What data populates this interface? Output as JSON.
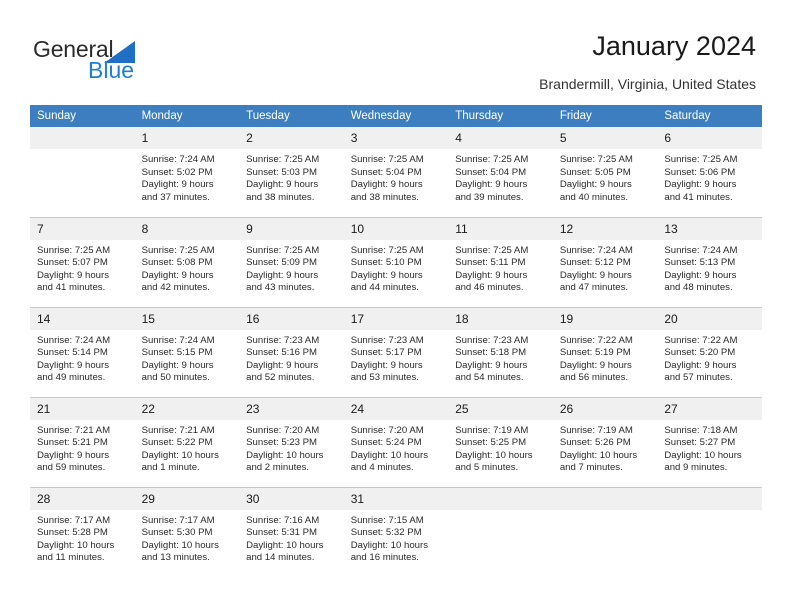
{
  "brand": {
    "name_top": "General",
    "name_bottom": "Blue",
    "accent_color": "#1f7fd0",
    "triangle_color": "#1f6fc4"
  },
  "header": {
    "title": "January 2024",
    "subtitle": "Brandermill, Virginia, United States"
  },
  "theme": {
    "header_row_bg": "#3c7ebf",
    "daynum_bg": "#f0f0f0",
    "grid_line": "#c9c9c9",
    "text_color": "#2b2b2b"
  },
  "weekday_headers": [
    "Sunday",
    "Monday",
    "Tuesday",
    "Wednesday",
    "Thursday",
    "Friday",
    "Saturday"
  ],
  "weeks": [
    [
      {
        "day": "",
        "sunrise": "",
        "sunset": "",
        "daylight1": "",
        "daylight2": ""
      },
      {
        "day": "1",
        "sunrise": "Sunrise: 7:24 AM",
        "sunset": "Sunset: 5:02 PM",
        "daylight1": "Daylight: 9 hours",
        "daylight2": "and 37 minutes."
      },
      {
        "day": "2",
        "sunrise": "Sunrise: 7:25 AM",
        "sunset": "Sunset: 5:03 PM",
        "daylight1": "Daylight: 9 hours",
        "daylight2": "and 38 minutes."
      },
      {
        "day": "3",
        "sunrise": "Sunrise: 7:25 AM",
        "sunset": "Sunset: 5:04 PM",
        "daylight1": "Daylight: 9 hours",
        "daylight2": "and 38 minutes."
      },
      {
        "day": "4",
        "sunrise": "Sunrise: 7:25 AM",
        "sunset": "Sunset: 5:04 PM",
        "daylight1": "Daylight: 9 hours",
        "daylight2": "and 39 minutes."
      },
      {
        "day": "5",
        "sunrise": "Sunrise: 7:25 AM",
        "sunset": "Sunset: 5:05 PM",
        "daylight1": "Daylight: 9 hours",
        "daylight2": "and 40 minutes."
      },
      {
        "day": "6",
        "sunrise": "Sunrise: 7:25 AM",
        "sunset": "Sunset: 5:06 PM",
        "daylight1": "Daylight: 9 hours",
        "daylight2": "and 41 minutes."
      }
    ],
    [
      {
        "day": "7",
        "sunrise": "Sunrise: 7:25 AM",
        "sunset": "Sunset: 5:07 PM",
        "daylight1": "Daylight: 9 hours",
        "daylight2": "and 41 minutes."
      },
      {
        "day": "8",
        "sunrise": "Sunrise: 7:25 AM",
        "sunset": "Sunset: 5:08 PM",
        "daylight1": "Daylight: 9 hours",
        "daylight2": "and 42 minutes."
      },
      {
        "day": "9",
        "sunrise": "Sunrise: 7:25 AM",
        "sunset": "Sunset: 5:09 PM",
        "daylight1": "Daylight: 9 hours",
        "daylight2": "and 43 minutes."
      },
      {
        "day": "10",
        "sunrise": "Sunrise: 7:25 AM",
        "sunset": "Sunset: 5:10 PM",
        "daylight1": "Daylight: 9 hours",
        "daylight2": "and 44 minutes."
      },
      {
        "day": "11",
        "sunrise": "Sunrise: 7:25 AM",
        "sunset": "Sunset: 5:11 PM",
        "daylight1": "Daylight: 9 hours",
        "daylight2": "and 46 minutes."
      },
      {
        "day": "12",
        "sunrise": "Sunrise: 7:24 AM",
        "sunset": "Sunset: 5:12 PM",
        "daylight1": "Daylight: 9 hours",
        "daylight2": "and 47 minutes."
      },
      {
        "day": "13",
        "sunrise": "Sunrise: 7:24 AM",
        "sunset": "Sunset: 5:13 PM",
        "daylight1": "Daylight: 9 hours",
        "daylight2": "and 48 minutes."
      }
    ],
    [
      {
        "day": "14",
        "sunrise": "Sunrise: 7:24 AM",
        "sunset": "Sunset: 5:14 PM",
        "daylight1": "Daylight: 9 hours",
        "daylight2": "and 49 minutes."
      },
      {
        "day": "15",
        "sunrise": "Sunrise: 7:24 AM",
        "sunset": "Sunset: 5:15 PM",
        "daylight1": "Daylight: 9 hours",
        "daylight2": "and 50 minutes."
      },
      {
        "day": "16",
        "sunrise": "Sunrise: 7:23 AM",
        "sunset": "Sunset: 5:16 PM",
        "daylight1": "Daylight: 9 hours",
        "daylight2": "and 52 minutes."
      },
      {
        "day": "17",
        "sunrise": "Sunrise: 7:23 AM",
        "sunset": "Sunset: 5:17 PM",
        "daylight1": "Daylight: 9 hours",
        "daylight2": "and 53 minutes."
      },
      {
        "day": "18",
        "sunrise": "Sunrise: 7:23 AM",
        "sunset": "Sunset: 5:18 PM",
        "daylight1": "Daylight: 9 hours",
        "daylight2": "and 54 minutes."
      },
      {
        "day": "19",
        "sunrise": "Sunrise: 7:22 AM",
        "sunset": "Sunset: 5:19 PM",
        "daylight1": "Daylight: 9 hours",
        "daylight2": "and 56 minutes."
      },
      {
        "day": "20",
        "sunrise": "Sunrise: 7:22 AM",
        "sunset": "Sunset: 5:20 PM",
        "daylight1": "Daylight: 9 hours",
        "daylight2": "and 57 minutes."
      }
    ],
    [
      {
        "day": "21",
        "sunrise": "Sunrise: 7:21 AM",
        "sunset": "Sunset: 5:21 PM",
        "daylight1": "Daylight: 9 hours",
        "daylight2": "and 59 minutes."
      },
      {
        "day": "22",
        "sunrise": "Sunrise: 7:21 AM",
        "sunset": "Sunset: 5:22 PM",
        "daylight1": "Daylight: 10 hours",
        "daylight2": "and 1 minute."
      },
      {
        "day": "23",
        "sunrise": "Sunrise: 7:20 AM",
        "sunset": "Sunset: 5:23 PM",
        "daylight1": "Daylight: 10 hours",
        "daylight2": "and 2 minutes."
      },
      {
        "day": "24",
        "sunrise": "Sunrise: 7:20 AM",
        "sunset": "Sunset: 5:24 PM",
        "daylight1": "Daylight: 10 hours",
        "daylight2": "and 4 minutes."
      },
      {
        "day": "25",
        "sunrise": "Sunrise: 7:19 AM",
        "sunset": "Sunset: 5:25 PM",
        "daylight1": "Daylight: 10 hours",
        "daylight2": "and 5 minutes."
      },
      {
        "day": "26",
        "sunrise": "Sunrise: 7:19 AM",
        "sunset": "Sunset: 5:26 PM",
        "daylight1": "Daylight: 10 hours",
        "daylight2": "and 7 minutes."
      },
      {
        "day": "27",
        "sunrise": "Sunrise: 7:18 AM",
        "sunset": "Sunset: 5:27 PM",
        "daylight1": "Daylight: 10 hours",
        "daylight2": "and 9 minutes."
      }
    ],
    [
      {
        "day": "28",
        "sunrise": "Sunrise: 7:17 AM",
        "sunset": "Sunset: 5:28 PM",
        "daylight1": "Daylight: 10 hours",
        "daylight2": "and 11 minutes."
      },
      {
        "day": "29",
        "sunrise": "Sunrise: 7:17 AM",
        "sunset": "Sunset: 5:30 PM",
        "daylight1": "Daylight: 10 hours",
        "daylight2": "and 13 minutes."
      },
      {
        "day": "30",
        "sunrise": "Sunrise: 7:16 AM",
        "sunset": "Sunset: 5:31 PM",
        "daylight1": "Daylight: 10 hours",
        "daylight2": "and 14 minutes."
      },
      {
        "day": "31",
        "sunrise": "Sunrise: 7:15 AM",
        "sunset": "Sunset: 5:32 PM",
        "daylight1": "Daylight: 10 hours",
        "daylight2": "and 16 minutes."
      },
      {
        "day": "",
        "sunrise": "",
        "sunset": "",
        "daylight1": "",
        "daylight2": ""
      },
      {
        "day": "",
        "sunrise": "",
        "sunset": "",
        "daylight1": "",
        "daylight2": ""
      },
      {
        "day": "",
        "sunrise": "",
        "sunset": "",
        "daylight1": "",
        "daylight2": ""
      }
    ]
  ]
}
